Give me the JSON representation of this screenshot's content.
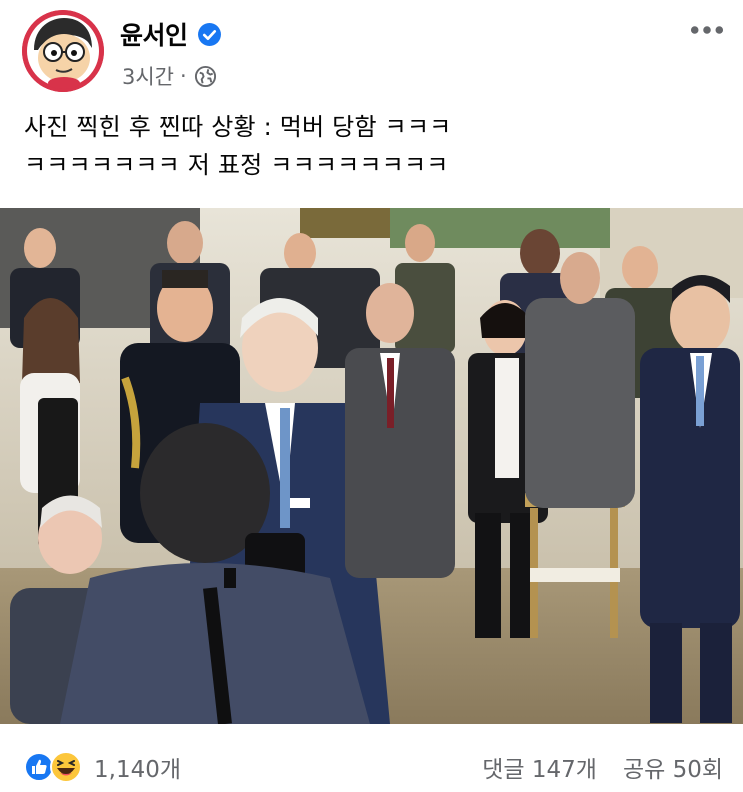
{
  "post": {
    "author": "윤서인",
    "time": "3시간",
    "meta_separator": "·",
    "text_line1": "사진 찍힌 후 찐따 상황 : 먹버 당함 ㅋㅋㅋ",
    "text_line2": "ㅋㅋㅋㅋㅋㅋㅋ 저 표정 ㅋㅋㅋㅋㅋㅋㅋㅋ",
    "more_label": "•••"
  },
  "footer": {
    "reaction_count": "1,140개",
    "comments": "댓글 147개",
    "shares": "공유 50회"
  },
  "icons": {
    "verified": "verified-badge-icon",
    "audience": "globe-icon",
    "reactions": [
      "like-reaction-icon",
      "haha-reaction-icon"
    ]
  },
  "colors": {
    "verified_blue": "#1877f2",
    "secondary_text": "#65676b",
    "avatar_red": "#d8334a"
  }
}
